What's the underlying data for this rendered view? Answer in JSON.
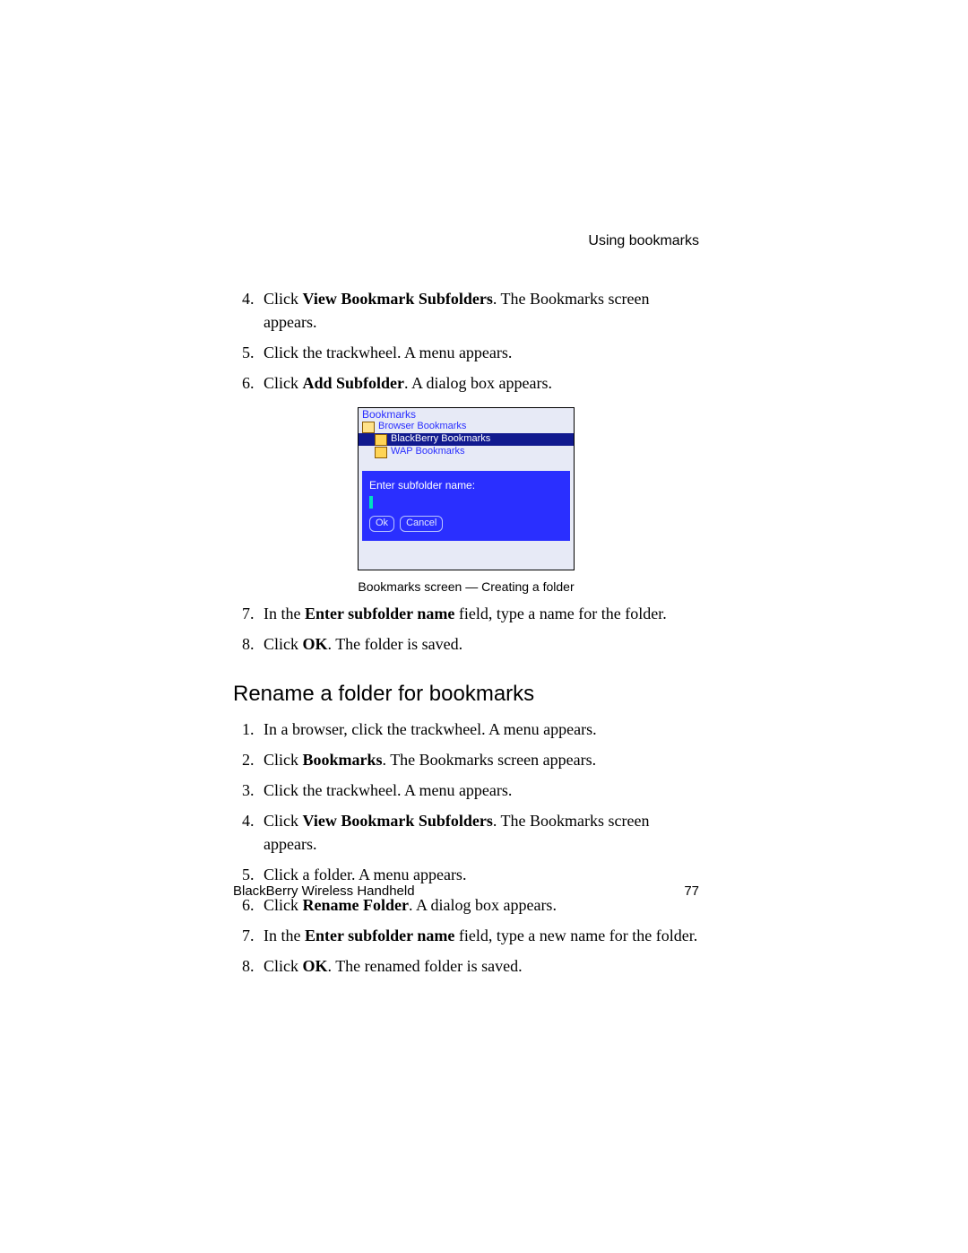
{
  "header": {
    "section_title": "Using bookmarks"
  },
  "listA": {
    "start": 4,
    "items": [
      {
        "pre": "Click ",
        "bold": "View Bookmark Subfolders",
        "post": ". The Bookmarks screen appears."
      },
      {
        "pre": "Click the trackwheel. A menu appears.",
        "bold": "",
        "post": ""
      },
      {
        "pre": "Click ",
        "bold": "Add Subfolder",
        "post": ". A dialog box appears."
      }
    ]
  },
  "screenshot": {
    "title": "Bookmarks",
    "row1": "Browser Bookmarks",
    "row2": "BlackBerry Bookmarks",
    "row3": "WAP Bookmarks",
    "dialog_label": "Enter subfolder name:",
    "ok": "Ok",
    "cancel": "Cancel",
    "caption": "Bookmarks screen — Creating a folder"
  },
  "listB": {
    "start": 7,
    "items": [
      {
        "pre": "In the ",
        "bold": "Enter subfolder name",
        "post": " field, type a name for the folder."
      },
      {
        "pre": "Click ",
        "bold": "OK",
        "post": ". The folder is saved."
      }
    ]
  },
  "section2_title": "Rename a folder for bookmarks",
  "listC": {
    "start": 1,
    "items": [
      {
        "pre": "In a browser, click the trackwheel. A menu appears.",
        "bold": "",
        "post": ""
      },
      {
        "pre": "Click ",
        "bold": "Bookmarks",
        "post": ". The Bookmarks screen appears."
      },
      {
        "pre": "Click the trackwheel. A menu appears.",
        "bold": "",
        "post": ""
      },
      {
        "pre": "Click ",
        "bold": "View Bookmark Subfolders",
        "post": ". The Bookmarks screen appears."
      },
      {
        "pre": "Click a folder. A menu appears.",
        "bold": "",
        "post": ""
      },
      {
        "pre": "Click ",
        "bold": "Rename Folder",
        "post": ". A dialog box appears."
      },
      {
        "pre": "In the ",
        "bold": "Enter subfolder name",
        "post": " field, type a new name for the folder."
      },
      {
        "pre": "Click ",
        "bold": "OK",
        "post": ". The renamed folder is saved."
      }
    ]
  },
  "footer": {
    "left": "BlackBerry Wireless Handheld",
    "right": "77"
  }
}
